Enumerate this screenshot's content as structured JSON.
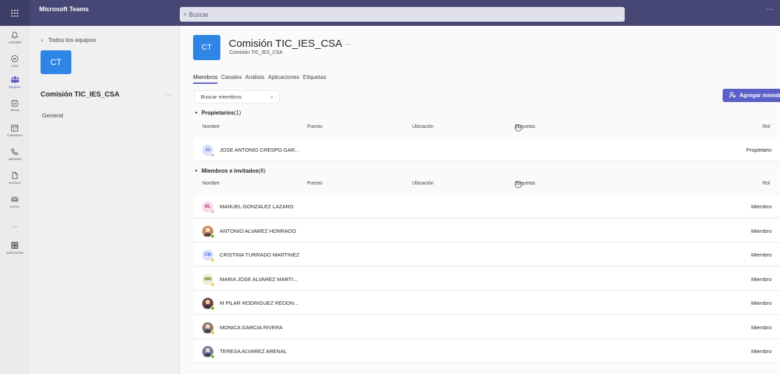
{
  "topbar": {
    "app_title": "Microsoft Teams",
    "search_placeholder": "Buscar",
    "more": "···"
  },
  "rail": {
    "items": [
      {
        "label": "Actividad",
        "icon": "bell-icon"
      },
      {
        "label": "Chat",
        "icon": "chat-icon"
      },
      {
        "label": "Equipos",
        "icon": "teams-icon"
      },
      {
        "label": "Tareas",
        "icon": "tasks-icon"
      },
      {
        "label": "Calendario",
        "icon": "calendar-icon"
      },
      {
        "label": "Llamadas",
        "icon": "phone-icon"
      },
      {
        "label": "Archivos",
        "icon": "file-icon"
      },
      {
        "label": "Correo",
        "icon": "mail-icon"
      },
      {
        "label": "",
        "icon": "more-icon"
      },
      {
        "label": "Aplicaciones",
        "icon": "apps-icon"
      }
    ]
  },
  "teampane": {
    "back_label": "Todos los equipos",
    "avatar_initials": "CT",
    "team_name": "Comisión TIC_IES_CSA",
    "more": "···",
    "channel_general": "General"
  },
  "header": {
    "avatar_initials": "CT",
    "title": "Comisión TIC_IES_CSA",
    "ellipsis": "···",
    "subtitle": "Comisión TIC_IES_CSA"
  },
  "tabs": [
    {
      "label": "Miembros",
      "active": true
    },
    {
      "label": "Canales"
    },
    {
      "label": "Análisis"
    },
    {
      "label": "Aplicaciones"
    },
    {
      "label": "Etiquetas"
    }
  ],
  "toolbar": {
    "search_placeholder": "Buscar miembros",
    "add_label": "Agregar miembro"
  },
  "columns": {
    "name": "Nombre",
    "puesto": "Puesto",
    "ubicacion": "Ubicación",
    "etiquetas": "Etiquetas",
    "rol": "Rol"
  },
  "owners": {
    "title": "Propietarios",
    "count": "(1)",
    "rows": [
      {
        "initials": "JG",
        "name": "JOSE ANTONIO CRESPO GAR...",
        "role": "Propietario",
        "bg": "#dde3f7",
        "fg": "#4f6bed",
        "status": "#c4c4c4"
      }
    ]
  },
  "members": {
    "title": "Miembros e invitados",
    "count": "(8)",
    "rows": [
      {
        "initials": "ML",
        "name": "MANUEL GONZALEZ LAZARO",
        "role": "Miembro",
        "bg": "#f6dcea",
        "fg": "#c2338a",
        "status": "#c4c4c4"
      },
      {
        "initials": "",
        "name": "ANTONIO ALVAREZ HONRADO",
        "role": "Miembro",
        "bg": "#c98a5e",
        "fg": "#fff",
        "status": "#6bb700",
        "photo": true
      },
      {
        "initials": "CM",
        "name": "CRISTINA TURRADO MARTINEZ",
        "role": "Miembro",
        "bg": "#dde3f7",
        "fg": "#4f6bed",
        "status": "#f8c22d"
      },
      {
        "initials": "MM",
        "name": "MARIA JOSE ALVAREZ MARTI...",
        "role": "Miembro",
        "bg": "#e8f0d5",
        "fg": "#5a7a1d",
        "status": "#f8c22d"
      },
      {
        "initials": "",
        "name": "M PILAR RODRIGUEZ REDON...",
        "role": "Miembro",
        "bg": "#6b4a3a",
        "fg": "#fff",
        "status": "#6bb700",
        "photo": true
      },
      {
        "initials": "",
        "name": "MONICA GARCIA RIVERA",
        "role": "Miembro",
        "bg": "#8a7a70",
        "fg": "#fff",
        "status": "#f8c22d",
        "photo": true
      },
      {
        "initials": "",
        "name": "TERESA ALVAREZ ARENAL",
        "role": "Miembro",
        "bg": "#6f7f96",
        "fg": "#fff",
        "status": "#6bb700",
        "photo": true
      }
    ]
  }
}
